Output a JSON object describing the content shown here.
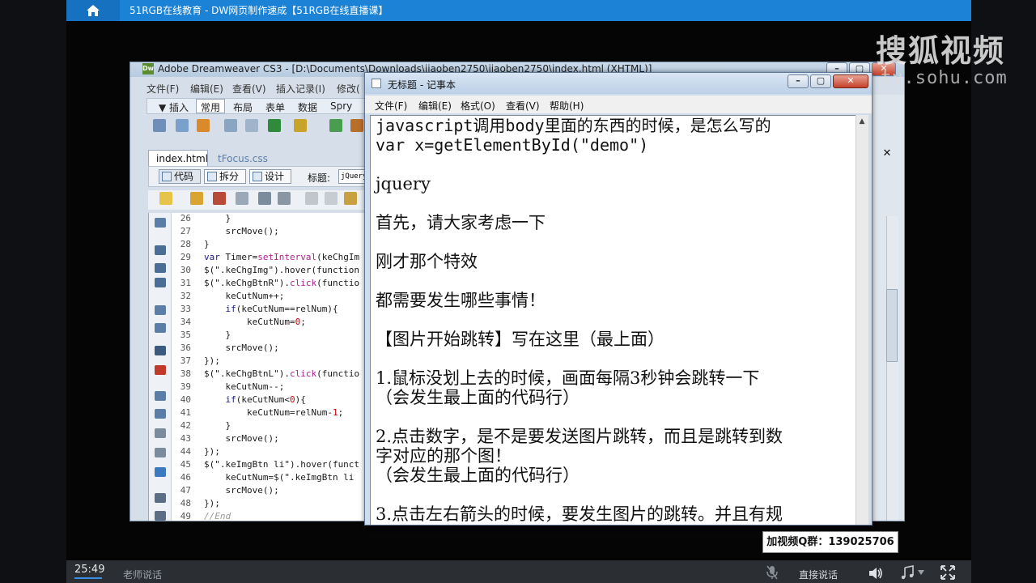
{
  "topbar": {
    "title": "51RGB在线教育 - DW网页制作速成【51RGB在线直播课】"
  },
  "watermark": {
    "brand": "搜狐视频",
    "url": "tv.sohu.com"
  },
  "dreamweaver": {
    "title": "Adobe Dreamweaver CS3 - [D:\\Documents\\Downloads\\jiaoben2750\\jiaoben2750\\index.html (XHTML)]",
    "logo": "Dw",
    "menu": [
      "文件(F)",
      "编辑(E)",
      "查看(V)",
      "插入记录(I)",
      "修改("
    ],
    "insert_tabs": [
      "▼ 插入",
      "常用",
      "布局",
      "表单",
      "数据",
      "Spry"
    ],
    "doc_tabs": [
      "index.html",
      "tFocus.css"
    ],
    "view_buttons": [
      "代码",
      "拆分",
      "设计"
    ],
    "title_label": "标题:",
    "title_value": "jQuery",
    "line_numbers": [
      "26",
      "27",
      "28",
      "29",
      "30",
      "31",
      "32",
      "33",
      "34",
      "35",
      "36",
      "37",
      "38",
      "39",
      "40",
      "41",
      "42",
      "43",
      "44",
      "45",
      "46",
      "47",
      "48",
      "49"
    ]
  },
  "notepad": {
    "title": "无标题 - 记事本",
    "menu": [
      "文件(F)",
      "编辑(E)",
      "格式(O)",
      "查看(V)",
      "帮助(H)"
    ],
    "lines": [
      "javascript调用body里面的东西的时候，是怎么写的",
      "var x=getElementById(\"demo\")",
      "",
      "jquery",
      "",
      "首先，请大家考虑一下",
      "",
      "刚才那个特效",
      "",
      "都需要发生哪些事情！",
      "",
      "【图片开始跳转】写在这里（最上面）",
      "",
      "1.鼠标没划上去的时候，画面每隔3秒钟会跳转一下",
      "（会发生最上面的代码行）",
      "",
      "2.点击数字，是不是要发送图片跳转，而且是跳转到数",
      "字对应的那个图！",
      "（会发生最上面的代码行）",
      "",
      "3.点击左右箭头的时候，要发生图片的跳转。并且有规"
    ]
  },
  "qq_badge": "加视频Q群：139025706",
  "player": {
    "time": "25:49",
    "teacher_talk": "老师说话",
    "live_talk": "直接说话"
  }
}
